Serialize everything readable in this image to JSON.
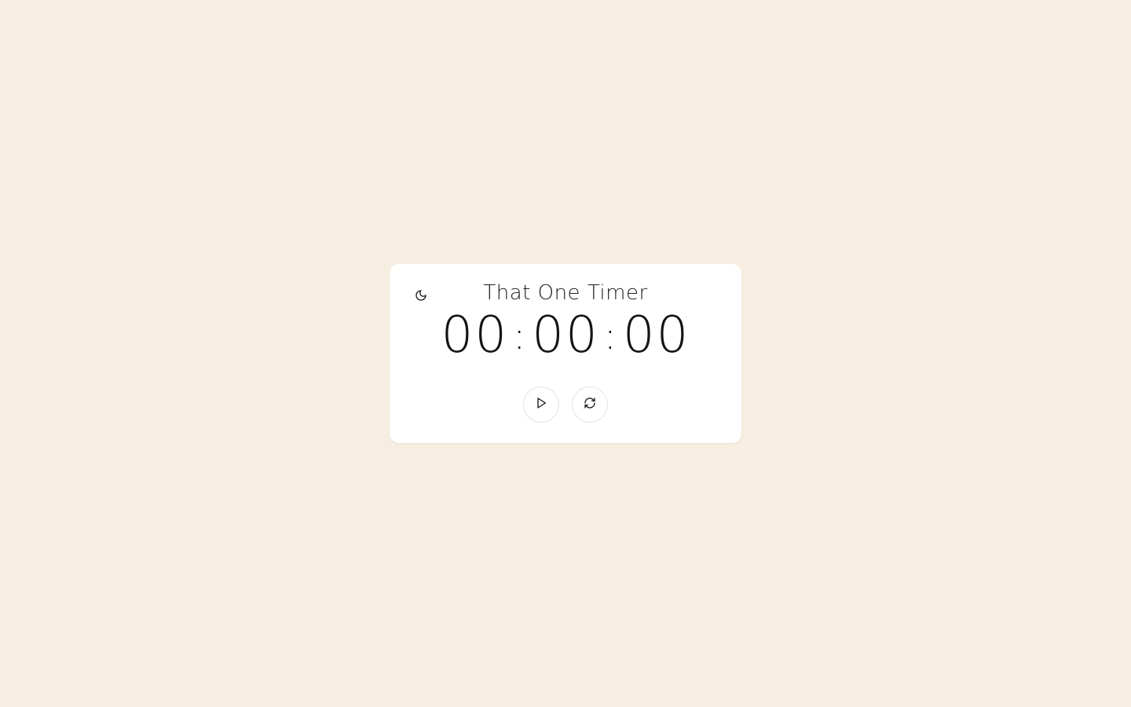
{
  "app": {
    "title": "That One Timer"
  },
  "timer": {
    "hours": "00",
    "minutes": "00",
    "seconds": "00",
    "separator": ":"
  },
  "controls": {
    "play_icon": "play-icon",
    "reset_icon": "refresh-icon",
    "theme_icon": "moon-icon"
  },
  "colors": {
    "background": "#f6eee1",
    "card": "#ffffff",
    "text": "#1b1b1b"
  }
}
